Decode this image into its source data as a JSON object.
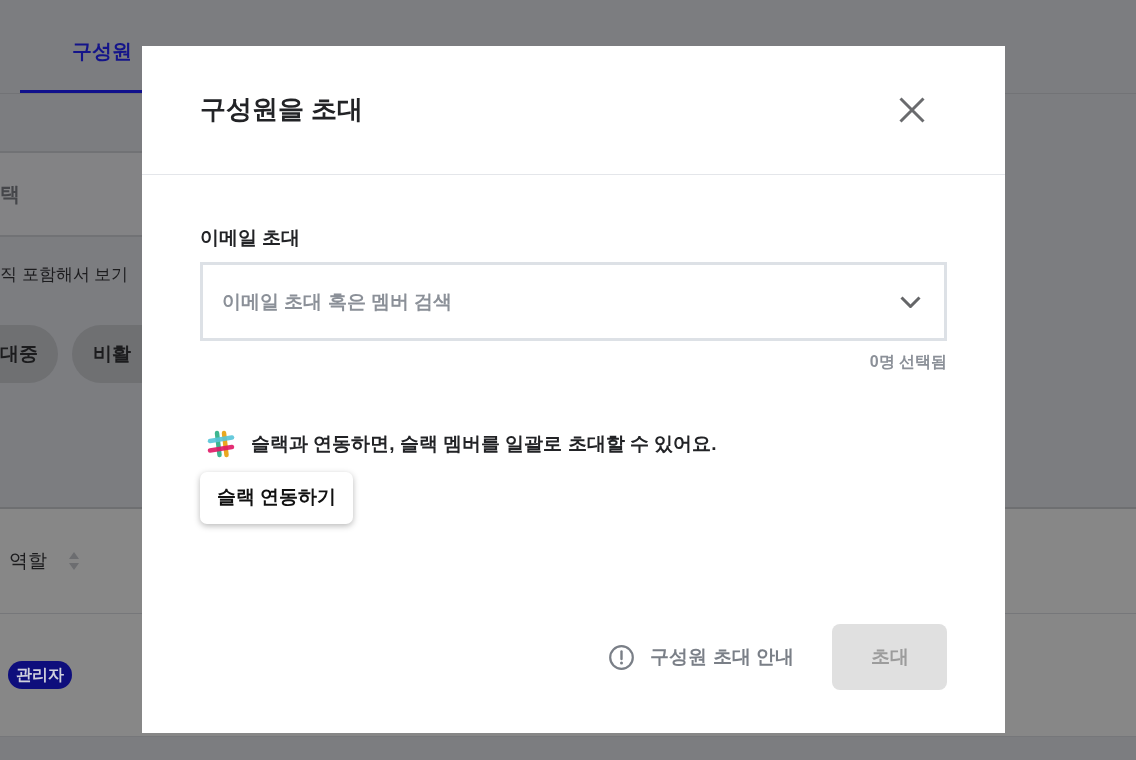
{
  "background": {
    "tabs": [
      {
        "label": "구성원",
        "selected": true
      }
    ],
    "dropdown": {
      "value": "택"
    },
    "option_label": "직 포함해서 보기",
    "filter_chips": [
      {
        "label": "대중",
        "selected": false
      },
      {
        "label": "비활",
        "selected": false
      }
    ],
    "table": {
      "columns": [
        {
          "label": "역할"
        }
      ],
      "rows": [
        [
          "관리자"
        ]
      ]
    }
  },
  "dialog": {
    "title": "구성원을 초대",
    "email_field": {
      "label": "이메일 초대",
      "placeholder": "이메일 초대 혹은 멤버 검색",
      "selected_count": "0명 선택됨"
    },
    "slack": {
      "message": "슬랙과 연동하면, 슬랙 멤버를 일괄로 초대할 수 있어요.",
      "button": "슬랙 연동하기"
    },
    "help_link": "구성원 초대 안내",
    "invite_button": {
      "label": "초대",
      "disabled": true
    }
  }
}
